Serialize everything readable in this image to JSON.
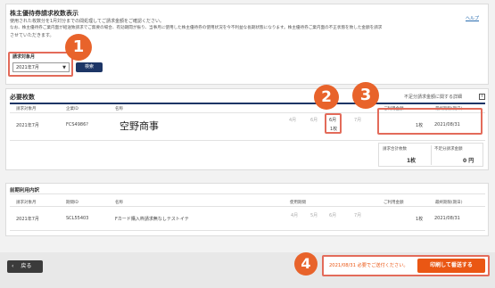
{
  "header": {
    "title": "株主優待券請求枚数表示",
    "help": "ヘルプ",
    "notes": [
      "使用された枚数分を1月対分までの間処理してご請求金額をご確認ください。",
      "なお、株主優待券ご業内面が紹送致請求でご無要の場合、有効期間が振り、当事月に使用した株主優待券の使用状況を今不利益な長期状態になります。株主優待券ご業内面の不正状態を致した金額を請求",
      "させていただきます。"
    ]
  },
  "search": {
    "label": "請求対象月",
    "selected": "2021年7月",
    "button": "検索"
  },
  "required": {
    "title": "必要枚数",
    "link": "不足分請求金額に関する詳細",
    "columns": [
      "請求対象月",
      "企業ID",
      "名称",
      "",
      "",
      "",
      "",
      "ご利用金額",
      "最終期限(期日)"
    ],
    "row": {
      "month": "2021年7月",
      "id": "FCS4986?",
      "name": "空野商事",
      "c1": "4月",
      "c2": "6月",
      "c3": "6月",
      "c3b": "1枚",
      "c4": "7月",
      "count": "1枚",
      "deadline": "2021/08/31"
    },
    "summary": {
      "label1": "請求合計枚数",
      "value1": "1枚",
      "label2": "不足分請求金額",
      "value2": "0 円"
    }
  },
  "history": {
    "title": "前期利用内訳",
    "columns": [
      "請求対象月",
      "期間ID",
      "名称",
      "使用期間",
      "",
      "",
      "",
      "ご利用金額",
      "最終期限(期日)"
    ],
    "row": {
      "month": "2021年7月",
      "id": "SCL55403",
      "name": "Fカード購入枠請求無なしテストイテ",
      "c1": "4月",
      "c2": "5月",
      "c3": "6月",
      "c4": "7月",
      "count": "1枚",
      "deadline": "2021/08/31"
    }
  },
  "footer": {
    "back": "戻る",
    "deadline_text": "2021/08/31 必要でご送付ください。",
    "print_button": "印刷して番送する"
  },
  "markers": [
    "1",
    "2",
    "3",
    "4"
  ],
  "colors": {
    "accent": "#ea5714",
    "marker": "#e8632b",
    "navy": "#1d3566",
    "highlight": "#e36b5a"
  }
}
